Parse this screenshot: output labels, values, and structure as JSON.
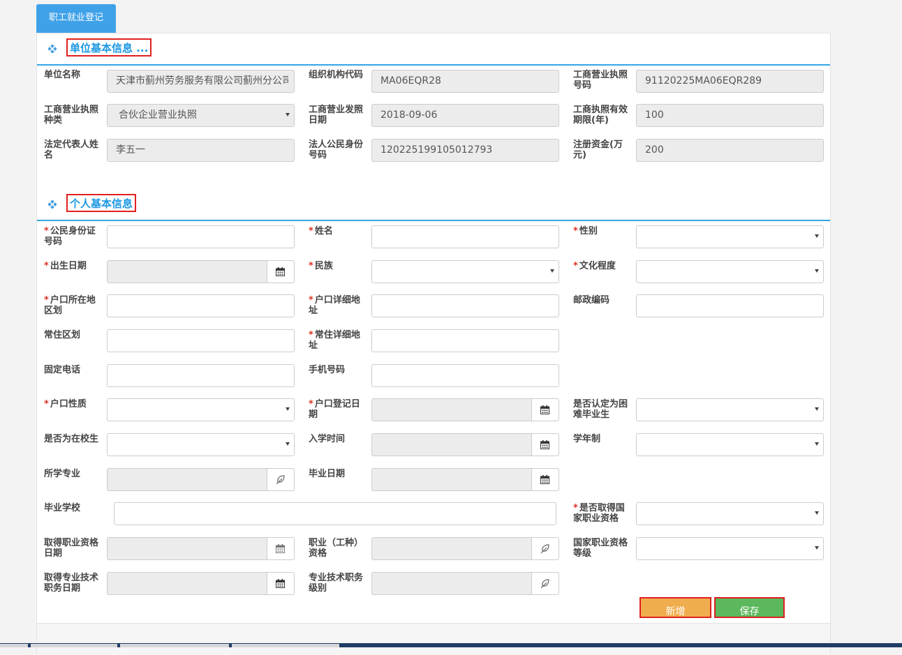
{
  "tab": {
    "label": "职工就业登记"
  },
  "sections": {
    "company": {
      "title": "单位基本信息 ..."
    },
    "personal": {
      "title": "个人基本信息"
    }
  },
  "company": {
    "name": {
      "label": "单位名称",
      "value": "天津市蓟州劳务服务有限公司蓟州分公司"
    },
    "org_code": {
      "label": "组织机构代码",
      "value": "MA06EQR28"
    },
    "license_no": {
      "label": "工商营业执照号码",
      "value": "91120225MA06EQR289"
    },
    "license_type": {
      "label": "工商营业执照种类",
      "value": "合伙企业营业执照"
    },
    "issue_date": {
      "label": "工商营业发照日期",
      "value": "2018-09-06"
    },
    "valid_years": {
      "label": "工商执照有效期限(年)",
      "value": "100"
    },
    "legal_rep": {
      "label": "法定代表人姓名",
      "value": "李五一"
    },
    "legal_id": {
      "label": "法人公民身份号码",
      "value": "120225199105012793"
    },
    "capital": {
      "label": "注册资金(万元)",
      "value": "200"
    }
  },
  "person": {
    "id_no": {
      "label": "公民身份证号码",
      "value": ""
    },
    "name": {
      "label": "姓名",
      "value": ""
    },
    "gender": {
      "label": "性别",
      "value": ""
    },
    "birth_date": {
      "label": "出生日期",
      "value": ""
    },
    "ethnicity": {
      "label": "民族",
      "value": ""
    },
    "education": {
      "label": "文化程度",
      "value": ""
    },
    "hukou_region": {
      "label": "户口所在地区划",
      "value": ""
    },
    "hukou_address": {
      "label": "户口详细地址",
      "value": ""
    },
    "postcode": {
      "label": "邮政编码",
      "value": ""
    },
    "residence_region": {
      "label": "常住区划",
      "value": ""
    },
    "residence_address": {
      "label": "常住详细地址",
      "value": ""
    },
    "landline": {
      "label": "固定电话",
      "value": ""
    },
    "mobile": {
      "label": "手机号码",
      "value": ""
    },
    "hukou_type": {
      "label": "户口性质",
      "value": ""
    },
    "hukou_date": {
      "label": "户口登记日期",
      "value": ""
    },
    "hardship_grad": {
      "label": "是否认定为困难毕业生",
      "value": ""
    },
    "is_student": {
      "label": "是否为在校生",
      "value": ""
    },
    "enroll_date": {
      "label": "入学时间",
      "value": ""
    },
    "school_years": {
      "label": "学年制",
      "value": ""
    },
    "major": {
      "label": "所学专业",
      "value": ""
    },
    "grad_date": {
      "label": "毕业日期",
      "value": ""
    },
    "school": {
      "label": "毕业学校",
      "value": ""
    },
    "has_cert": {
      "label": "是否取得国家职业资格",
      "value": ""
    },
    "cert_date": {
      "label": "取得职业资格日期",
      "value": ""
    },
    "cert_type": {
      "label": "职业（工种）资格",
      "value": ""
    },
    "cert_level": {
      "label": "国家职业资格等级",
      "value": ""
    },
    "title_date": {
      "label": "取得专业技术职务日期",
      "value": ""
    },
    "title_level": {
      "label": "专业技术职务级别",
      "value": ""
    }
  },
  "buttons": {
    "add": "新增",
    "save": "保存"
  },
  "colors": {
    "accent": "#1d98e2",
    "tab": "#3fa2e9",
    "add": "#f0ad4e",
    "save": "#5cb85c",
    "required": "#dd3322"
  },
  "icons": {
    "calendar": "calendar-icon",
    "picker": "leaf-picker-icon",
    "section": "diamond-cluster-icon"
  }
}
